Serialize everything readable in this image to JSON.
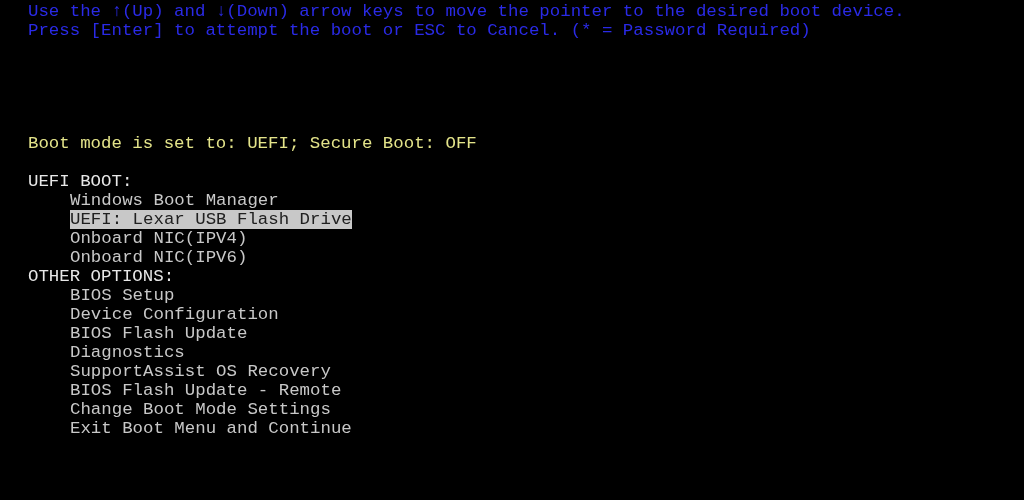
{
  "instructions": [
    "Use the ↑(Up) and ↓(Down) arrow keys to move the pointer to the desired boot device.",
    "Press [Enter] to attempt the boot or ESC to Cancel. (* = Password Required)"
  ],
  "boot_mode": "Boot mode is set to: UEFI; Secure Boot: OFF",
  "sections": [
    {
      "heading": "UEFI BOOT:",
      "items": [
        {
          "label": "Windows Boot Manager",
          "selected": false
        },
        {
          "label": "UEFI: Lexar USB Flash Drive",
          "selected": true
        },
        {
          "label": "Onboard NIC(IPV4)",
          "selected": false
        },
        {
          "label": "Onboard NIC(IPV6)",
          "selected": false
        }
      ]
    },
    {
      "heading": "OTHER OPTIONS:",
      "items": [
        {
          "label": "BIOS Setup",
          "selected": false
        },
        {
          "label": "Device Configuration",
          "selected": false
        },
        {
          "label": "BIOS Flash Update",
          "selected": false
        },
        {
          "label": "Diagnostics",
          "selected": false
        },
        {
          "label": "SupportAssist OS Recovery",
          "selected": false
        },
        {
          "label": "BIOS Flash Update - Remote",
          "selected": false
        },
        {
          "label": "Change Boot Mode Settings",
          "selected": false
        },
        {
          "label": "Exit Boot Menu and Continue",
          "selected": false
        }
      ]
    }
  ]
}
